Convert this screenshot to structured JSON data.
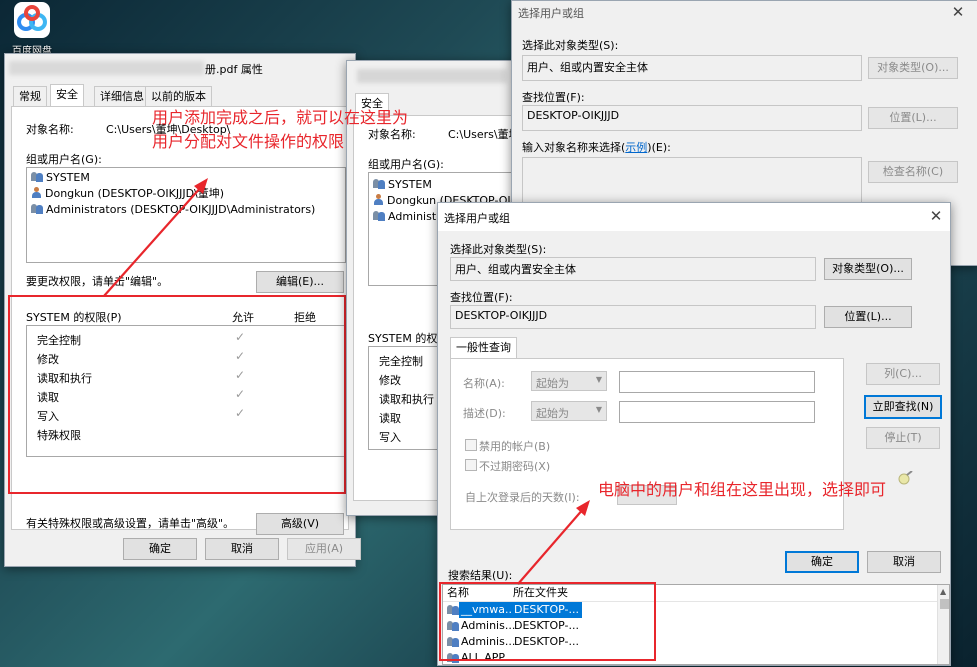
{
  "desktop": {
    "icon_label": "百度网盘"
  },
  "props": {
    "title": "册.pdf 属性",
    "tabs": [
      "常规",
      "安全",
      "详细信息",
      "以前的版本"
    ],
    "object_label": "对象名称:",
    "object_value": "C:\\Users\\董坤\\Desktop\\",
    "group_label": "组或用户名(G):",
    "users": [
      {
        "name": "SYSTEM",
        "icon": "group-icon"
      },
      {
        "name": "Dongkun (DESKTOP-OIKJJJD\\董坤)",
        "icon": "user-icon"
      },
      {
        "name": "Administrators (DESKTOP-OIKJJJD\\Administrators)",
        "icon": "group-icon"
      }
    ],
    "edit_hint": "要更改权限，请单击\"编辑\"。",
    "edit_button": "编辑(E)...",
    "perm_title": "SYSTEM 的权限(P)",
    "allow_header": "允许",
    "deny_header": "拒绝",
    "permissions": [
      {
        "name": "完全控制",
        "allow": true
      },
      {
        "name": "修改",
        "allow": true
      },
      {
        "name": "读取和执行",
        "allow": true
      },
      {
        "name": "读取",
        "allow": true
      },
      {
        "name": "写入",
        "allow": true
      },
      {
        "name": "特殊权限",
        "allow": false
      }
    ],
    "advanced_hint": "有关特殊权限或高级设置，请单击\"高级\"。",
    "advanced_button": "高级(V)",
    "ok_button": "确定",
    "cancel_button": "取消",
    "apply_button": "应用(A)"
  },
  "perm": {
    "tab": "安全",
    "object_label": "对象名称:",
    "object_value": "C:\\Users\\董坤",
    "group_label": "组或用户名(G):",
    "users": [
      {
        "name": "SYSTEM",
        "icon": "group-icon"
      },
      {
        "name": "Dongkun (DESKTOP-OIKJJ",
        "icon": "user-icon"
      },
      {
        "name": "Administrators",
        "icon": "group-icon"
      }
    ],
    "perm_title": "SYSTEM 的权限",
    "permissions": [
      "完全控制",
      "修改",
      "读取和执行",
      "读取",
      "写入"
    ]
  },
  "select1": {
    "title": "选择用户或组",
    "type_label": "选择此对象类型(S):",
    "type_value": "用户、组或内置安全主体",
    "type_button": "对象类型(O)...",
    "loc_label": "查找位置(F):",
    "loc_value": "DESKTOP-OIKJJJD",
    "loc_button": "位置(L)...",
    "enter_label_pre": "输入对象名称来选择(",
    "enter_label_link": "示例",
    "enter_label_post": ")(E):",
    "check_button": "检查名称(C)"
  },
  "adv": {
    "title": "选择用户或组",
    "type_label": "选择此对象类型(S):",
    "type_value": "用户、组或内置安全主体",
    "type_button": "对象类型(O)...",
    "loc_label": "查找位置(F):",
    "loc_value": "DESKTOP-OIKJJJD",
    "loc_button": "位置(L)...",
    "query_tab": "一般性查询",
    "name_label": "名称(A):",
    "desc_label": "描述(D):",
    "starts_with": "起始为",
    "disabled_accounts": "禁用的帐户(B)",
    "no_expire": "不过期密码(X)",
    "days_label": "自上次登录后的天数(I):",
    "columns_button": "列(C)...",
    "find_now_button": "立即查找(N)",
    "stop_button": "停止(T)",
    "ok_button": "确定",
    "cancel_button": "取消",
    "results_label": "搜索结果(U):",
    "results_headers": [
      "名称",
      "所在文件夹"
    ],
    "results": [
      {
        "name": "__vmwa...",
        "folder": "DESKTOP-..."
      },
      {
        "name": "Adminis...",
        "folder": "DESKTOP-..."
      },
      {
        "name": "Adminis...",
        "folder": "DESKTOP-..."
      },
      {
        "name": "ALL APP...",
        "folder": ""
      }
    ]
  },
  "annotations": {
    "top_line1": "用户添加完成之后，就可以在这里为",
    "top_line2": "用户分配对文件操作的权限",
    "bottom": "电脑中的用户和组在这里出现，选择即可"
  },
  "colors": {
    "annotation_red": "#e8262c",
    "selection_blue": "#0078d7"
  }
}
